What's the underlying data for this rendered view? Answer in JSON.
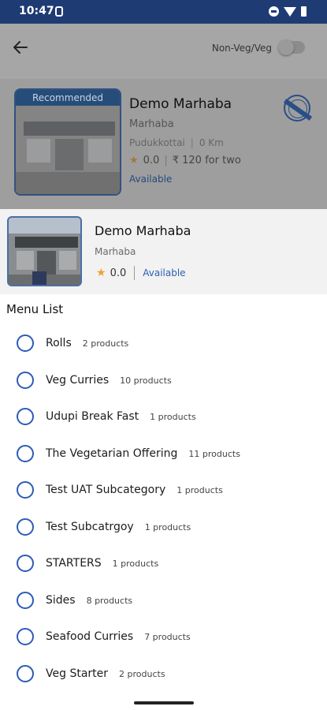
{
  "status_bar": {
    "time": "10:47"
  },
  "app_bar": {
    "filter_label": "Non-Veg/Veg"
  },
  "background_card": {
    "ribbon": "Recommended",
    "title": "Demo Marhaba",
    "subtitle": "Marhaba",
    "location": "Pudukkottai",
    "distance": "0 Km",
    "rating": "0.0",
    "price": "₹ 120 for two",
    "availability": "Available"
  },
  "sheet": {
    "title": "Demo Marhaba",
    "subtitle": "Marhaba",
    "rating": "0.0",
    "availability": "Available",
    "menu_heading": "Menu List",
    "menu_items": [
      {
        "name": "Rolls",
        "count": "2 products"
      },
      {
        "name": "Veg Curries",
        "count": "10 products"
      },
      {
        "name": "Udupi Break Fast",
        "count": "1 products"
      },
      {
        "name": "The Vegetarian Offering",
        "count": "11 products"
      },
      {
        "name": "Test UAT Subcategory",
        "count": "1 products"
      },
      {
        "name": "Test Subcatrgoy",
        "count": "1 products"
      },
      {
        "name": "STARTERS",
        "count": "1 products"
      },
      {
        "name": "Sides",
        "count": "8 products"
      },
      {
        "name": "Seafood Curries",
        "count": "7 products"
      },
      {
        "name": "Veg Starter",
        "count": "2 products"
      }
    ]
  },
  "colors": {
    "status_bar": "#1f3b73",
    "accent": "#2d5bb7",
    "star": "#f0a030"
  }
}
